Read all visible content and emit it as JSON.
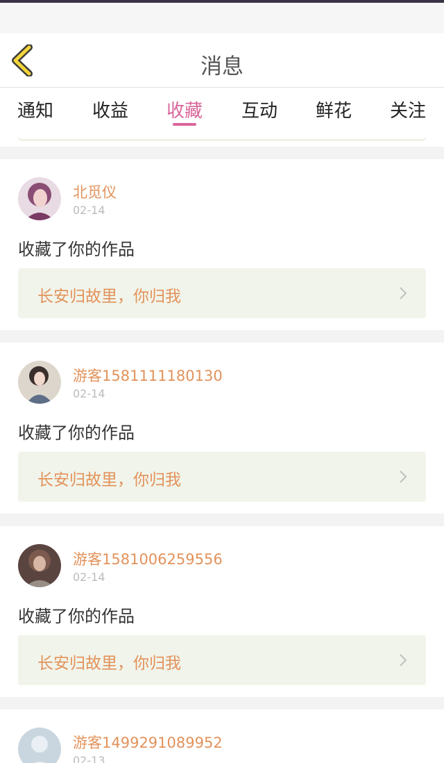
{
  "header": {
    "title": "消息",
    "back_icon": "back-chevron-icon"
  },
  "tabs": [
    {
      "label": "通知"
    },
    {
      "label": "收益"
    },
    {
      "label": "收藏",
      "active": true
    },
    {
      "label": "互动"
    },
    {
      "label": "鲜花"
    },
    {
      "label": "关注"
    }
  ],
  "colors": {
    "accent": "#d9669a",
    "name": "#e2925b",
    "work_bg": "#f1f4ea",
    "back_icon_fill": "#f3d53b"
  },
  "notifications": [
    {
      "user": "北觅仪",
      "date": "02-14",
      "action": "收藏了你的作品",
      "work": "长安归故里，你归我"
    },
    {
      "user": "游客1581111180130",
      "date": "02-14",
      "action": "收藏了你的作品",
      "work": "长安归故里，你归我"
    },
    {
      "user": "游客1581006259556",
      "date": "02-14",
      "action": "收藏了你的作品",
      "work": "长安归故里，你归我"
    },
    {
      "user": "游客1499291089952",
      "date": "02-13"
    }
  ]
}
